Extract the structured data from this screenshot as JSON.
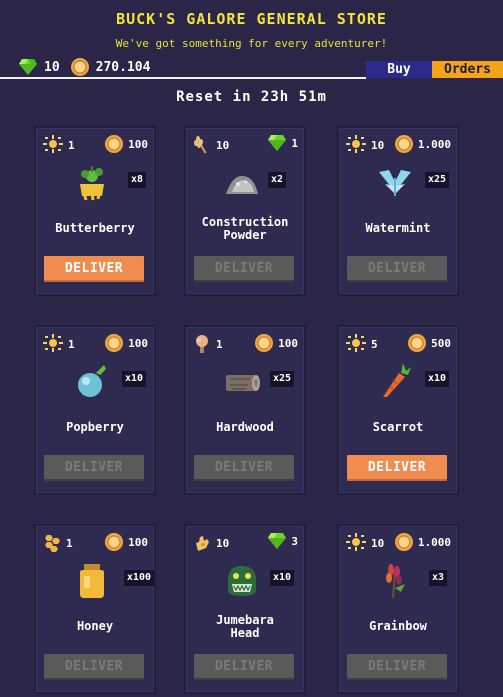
{
  "store": {
    "title": "BUCK'S GALORE GENERAL STORE",
    "subtitle": "We've got something for every adventurer!",
    "gems": "10",
    "coins": "270.104",
    "tab_buy": "Buy",
    "tab_orders": "Orders",
    "reset": "Reset in 23h 51m"
  },
  "colors": {
    "background": "#2b2547",
    "title": "#f4e43a",
    "deliver_active": "#ef8c4e",
    "deliver_disabled": "#5a5a5a",
    "tab_buy": "#2c2a8c",
    "tab_orders": "#f4a418"
  },
  "orders": [
    {
      "name": "Butterberry",
      "req_icon": "sun-flower-icon",
      "req_qty": "1",
      "reward_icon": "coin-icon",
      "reward_qty": "100",
      "item_icon": "butterberry-icon",
      "qty": "x8",
      "deliver": "DELIVER",
      "deliverable": true
    },
    {
      "name": "Construction Powder",
      "req_icon": "wheat-icon",
      "req_qty": "10",
      "reward_icon": "gem-icon",
      "reward_qty": "1",
      "item_icon": "powder-pile-icon",
      "qty": "x2",
      "deliver": "DELIVER",
      "deliverable": false
    },
    {
      "name": "Watermint",
      "req_icon": "sun-flower-icon",
      "req_qty": "10",
      "reward_icon": "coin-icon",
      "reward_qty": "1.000",
      "item_icon": "watermint-icon",
      "qty": "x25",
      "deliver": "DELIVER",
      "deliverable": false
    },
    {
      "name": "Popberry",
      "req_icon": "sun-flower-icon",
      "req_qty": "1",
      "reward_icon": "coin-icon",
      "reward_qty": "100",
      "item_icon": "popberry-icon",
      "qty": "x10",
      "deliver": "DELIVER",
      "deliverable": false
    },
    {
      "name": "Hardwood",
      "req_icon": "tree-icon",
      "req_qty": "1",
      "reward_icon": "coin-icon",
      "reward_qty": "100",
      "item_icon": "log-icon",
      "qty": "x25",
      "deliver": "DELIVER",
      "deliverable": false
    },
    {
      "name": "Scarrot",
      "req_icon": "sun-flower-icon",
      "req_qty": "5",
      "reward_icon": "coin-icon",
      "reward_qty": "500",
      "item_icon": "carrot-icon",
      "qty": "x10",
      "deliver": "DELIVER",
      "deliverable": true
    },
    {
      "name": "Honey",
      "req_icon": "honeycomb-icon",
      "req_qty": "1",
      "reward_icon": "coin-icon",
      "reward_qty": "100",
      "item_icon": "honey-jar-icon",
      "qty": "x100",
      "deliver": "DELIVER",
      "deliverable": false
    },
    {
      "name": "Jumebara Head",
      "req_icon": "hand-icon",
      "req_qty": "10",
      "reward_icon": "gem-icon",
      "reward_qty": "3",
      "item_icon": "creature-head-icon",
      "qty": "x10",
      "deliver": "DELIVER",
      "deliverable": false
    },
    {
      "name": "Grainbow",
      "req_icon": "sun-flower-icon",
      "req_qty": "10",
      "reward_icon": "coin-icon",
      "reward_qty": "1.000",
      "item_icon": "grainbow-icon",
      "qty": "x3",
      "deliver": "DELIVER",
      "deliverable": false
    }
  ]
}
